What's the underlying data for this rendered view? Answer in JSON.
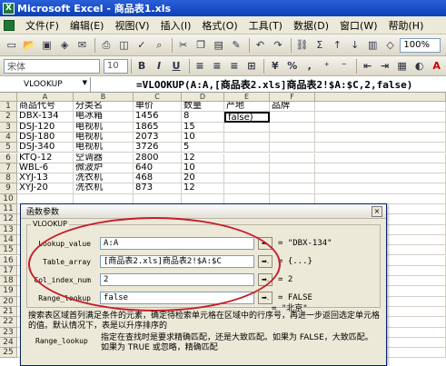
{
  "window": {
    "app_icon": "X",
    "title": "Microsoft Excel - 商品表1.xls"
  },
  "menu": [
    "文件(F)",
    "编辑(E)",
    "视图(V)",
    "插入(I)",
    "格式(O)",
    "工具(T)",
    "数据(D)",
    "窗口(W)",
    "帮助(H)"
  ],
  "toolbar": {
    "icons": [
      "new-icon",
      "open-icon",
      "save-icon",
      "permission-icon",
      "email-icon",
      "print-icon",
      "print-preview-icon",
      "spellcheck-icon",
      "research-icon",
      "cut-icon",
      "copy-icon",
      "paste-icon",
      "format-painter-icon",
      "undo-icon",
      "redo-icon",
      "hyperlink-icon",
      "autosum-icon",
      "sort-asc-icon",
      "sort-desc-icon",
      "chart-icon",
      "drawing-icon"
    ],
    "zoom": "100%"
  },
  "format_bar": {
    "font": "宋体",
    "size": "10"
  },
  "formula_bar": {
    "name_box": "VLOOKUP",
    "formula": "=VLOOKUP(A:A,[商品表2.xls]商品表2!$A:$C,2,false)"
  },
  "sheet": {
    "columns": [
      "A",
      "B",
      "C",
      "D",
      "E",
      "F"
    ],
    "rows": [
      {
        "num": "1",
        "cells": [
          "商品代号",
          "分类名",
          "单价",
          "数量",
          "产地",
          "品牌"
        ]
      },
      {
        "num": "2",
        "cells": [
          "DBX-134",
          "电冰箱",
          "1456",
          "8",
          "false)",
          ""
        ]
      },
      {
        "num": "3",
        "cells": [
          "DSJ-120",
          "电视机",
          "1865",
          "15",
          "",
          ""
        ]
      },
      {
        "num": "4",
        "cells": [
          "DSJ-180",
          "电视机",
          "2073",
          "10",
          "",
          ""
        ]
      },
      {
        "num": "5",
        "cells": [
          "DSJ-340",
          "电视机",
          "3726",
          "5",
          "",
          ""
        ]
      },
      {
        "num": "6",
        "cells": [
          "KTQ-12",
          "空调器",
          "2800",
          "12",
          "",
          ""
        ]
      },
      {
        "num": "7",
        "cells": [
          "WBL-6",
          "微波炉",
          "640",
          "10",
          "",
          ""
        ]
      },
      {
        "num": "8",
        "cells": [
          "XYJ-13",
          "洗衣机",
          "468",
          "20",
          "",
          ""
        ]
      },
      {
        "num": "9",
        "cells": [
          "XYJ-20",
          "洗衣机",
          "873",
          "12",
          "",
          ""
        ]
      },
      {
        "num": "10",
        "cells": [
          "",
          "",
          "",
          "",
          "",
          ""
        ]
      },
      {
        "num": "11",
        "cells": [
          "",
          "",
          "",
          "",
          "",
          ""
        ]
      },
      {
        "num": "12",
        "cells": [
          "",
          "",
          "",
          "",
          "",
          ""
        ]
      },
      {
        "num": "13",
        "cells": [
          "",
          "",
          "",
          "",
          "",
          ""
        ]
      },
      {
        "num": "14",
        "cells": [
          "",
          "",
          "",
          "",
          "",
          ""
        ]
      },
      {
        "num": "15",
        "cells": [
          "",
          "",
          "",
          "",
          "",
          ""
        ]
      },
      {
        "num": "16",
        "cells": [
          "",
          "",
          "",
          "",
          "",
          ""
        ]
      },
      {
        "num": "17",
        "cells": [
          "",
          "",
          "",
          "",
          "",
          ""
        ]
      },
      {
        "num": "18",
        "cells": [
          "",
          "",
          "",
          "",
          "",
          ""
        ]
      },
      {
        "num": "19",
        "cells": [
          "",
          "",
          "",
          "",
          "",
          ""
        ]
      },
      {
        "num": "20",
        "cells": [
          "",
          "",
          "",
          "",
          "",
          ""
        ]
      },
      {
        "num": "21",
        "cells": [
          "",
          "",
          "",
          "",
          "",
          ""
        ]
      },
      {
        "num": "22",
        "cells": [
          "",
          "",
          "",
          "",
          "",
          ""
        ]
      },
      {
        "num": "23",
        "cells": [
          "",
          "",
          "",
          "",
          "",
          ""
        ]
      },
      {
        "num": "24",
        "cells": [
          "",
          "",
          "",
          "",
          "",
          ""
        ]
      },
      {
        "num": "25",
        "cells": [
          "",
          "",
          "",
          "",
          "",
          ""
        ]
      },
      {
        "num": "26",
        "cells": [
          "",
          "",
          "",
          "",
          "",
          ""
        ]
      }
    ]
  },
  "dialog": {
    "title": "函数参数",
    "close": "×",
    "function_name": "VLOOKUP",
    "ref_button": "➡.",
    "args": [
      {
        "label": "Lookup_value",
        "value": "A:A",
        "result": "= \"DBX-134\""
      },
      {
        "label": "Table_array",
        "value": "[商品表2.xls]商品表2!$A:$C",
        "result": "= {...}"
      },
      {
        "label": "Col_index_num",
        "value": "2",
        "result": "= 2"
      },
      {
        "label": "Range_lookup",
        "value": "false",
        "result": "= FALSE"
      }
    ],
    "result": "= \"北京\"",
    "description": "搜索表区域首列满足条件的元素，确定待检索单元格在区域中的行序号，再进一步返回选定单元格的值。默认情况下，表是以升序排序的",
    "arg_name": "Range_lookup",
    "arg_desc": "指定在查找时是要求精确匹配，还是大致匹配。如果为 FALSE，大致匹配。如果为 TRUE 或忽略，精确匹配"
  }
}
